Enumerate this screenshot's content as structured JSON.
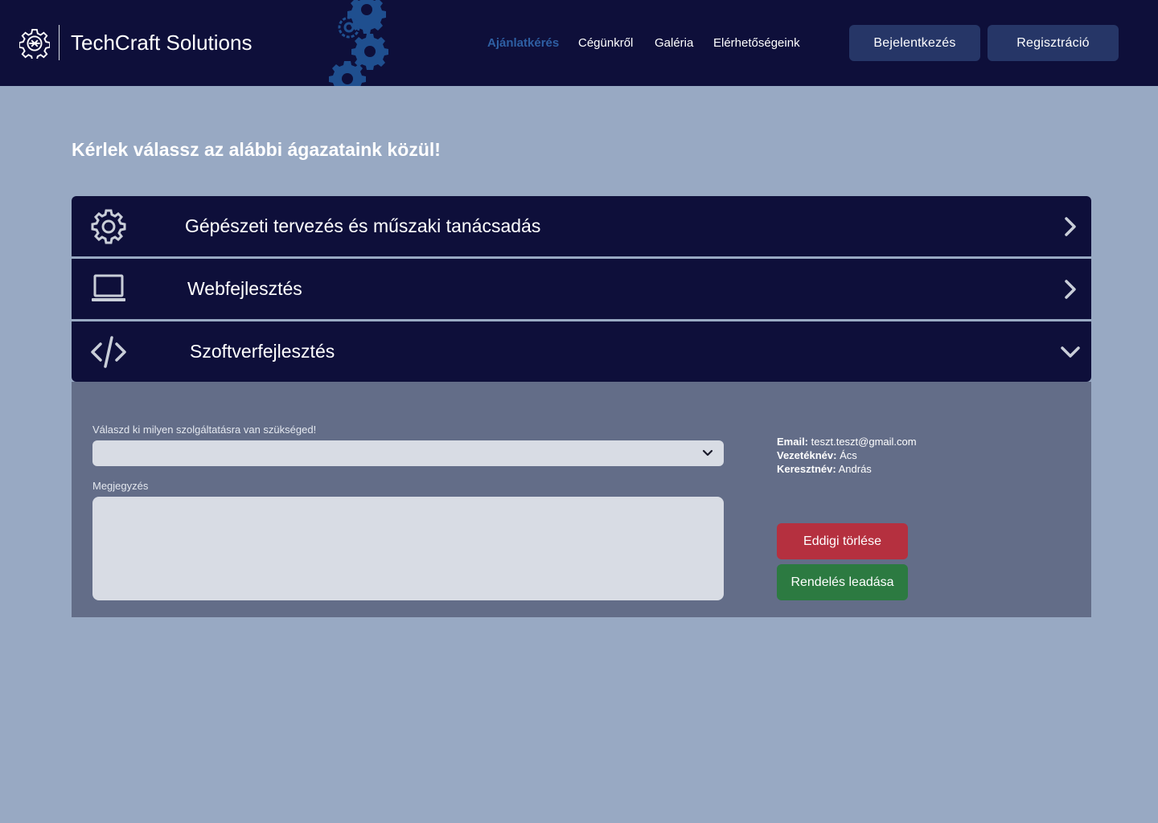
{
  "header": {
    "brand": "TechCraft Solutions",
    "nav": [
      {
        "label": "Ajánlatkérés",
        "active": true
      },
      {
        "label": "Cégünkről"
      },
      {
        "label": "Galéria"
      },
      {
        "label": "Elérhetőségeink"
      }
    ],
    "login_label": "Bejelentkezés",
    "register_label": "Regisztráció"
  },
  "main": {
    "heading": "Kérlek válassz az alábbi ágazataink közül!",
    "sectors": [
      {
        "label": "Gépészeti tervezés és műszaki tanácsadás",
        "icon": "gear-icon",
        "state": "collapsed"
      },
      {
        "label": "Webfejlesztés",
        "icon": "laptop-icon",
        "state": "collapsed"
      },
      {
        "label": "Szoftverfejlesztés",
        "icon": "code-icon",
        "state": "expanded"
      }
    ],
    "form": {
      "service_label": "Válaszd ki milyen szolgáltatásra van szükséged!",
      "service_value": "",
      "note_label": "Megjegyzés",
      "note_value": "",
      "email_label": "Email:",
      "email_value": "teszt.teszt@gmail.com",
      "lastname_label": "Vezetéknév:",
      "lastname_value": "Ács",
      "firstname_label": "Keresztnév:",
      "firstname_value": "András",
      "clear_label": "Eddigi törlése",
      "submit_label": "Rendelés leadása"
    }
  },
  "colors": {
    "header_bg": "#0e0f3a",
    "page_bg": "#98a9c3",
    "panel_bg": "#636d88",
    "active_nav": "#2e5fa3",
    "danger": "#b5303f",
    "success": "#2c7a41"
  }
}
